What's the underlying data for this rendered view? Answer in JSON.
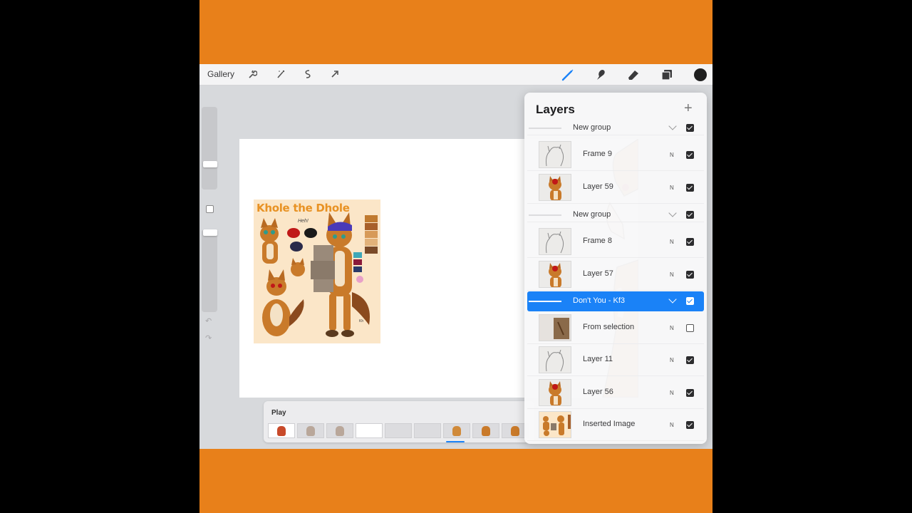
{
  "toolbar": {
    "gallery_label": "Gallery",
    "left_tools": [
      "wrench-icon",
      "magic-wand-icon",
      "selection-icon",
      "transform-arrow-icon"
    ],
    "right_tools": [
      "brush-icon",
      "smudge-icon",
      "eraser-icon",
      "layers-icon",
      "color-circle"
    ],
    "active_color": "#1f1f1f",
    "accent": "#1a82f7"
  },
  "canvas": {
    "sheet_title": "Khole the Dhole",
    "sheet_note": "Heh!"
  },
  "animation": {
    "play_label": "Play",
    "frame_count": 9,
    "active_frame": 4
  },
  "layers_panel": {
    "title": "Layers",
    "add_icon": "+",
    "rows": [
      {
        "kind": "group",
        "name": "New group",
        "checked": true
      },
      {
        "kind": "layer",
        "name": "Frame 9",
        "blend": "N",
        "checked": true,
        "thumb": "sketch"
      },
      {
        "kind": "layer",
        "name": "Layer 59",
        "blend": "N",
        "checked": true,
        "thumb": "color"
      },
      {
        "kind": "group",
        "name": "New group",
        "checked": true
      },
      {
        "kind": "layer",
        "name": "Frame 8",
        "blend": "N",
        "checked": true,
        "thumb": "sketch"
      },
      {
        "kind": "layer",
        "name": "Layer 57",
        "blend": "N",
        "checked": true,
        "thumb": "color"
      },
      {
        "kind": "group",
        "name": "Don't You -  Kf3",
        "checked": true,
        "selected": true
      },
      {
        "kind": "layer",
        "name": "From selection",
        "blend": "N",
        "checked": false,
        "thumb": "brown"
      },
      {
        "kind": "layer",
        "name": "Layer 11",
        "blend": "N",
        "checked": true,
        "thumb": "sketch"
      },
      {
        "kind": "layer",
        "name": "Layer 56",
        "blend": "N",
        "checked": true,
        "thumb": "color"
      },
      {
        "kind": "layer",
        "name": "Inserted Image",
        "blend": "N",
        "checked": true,
        "thumb": "sheet"
      }
    ]
  }
}
